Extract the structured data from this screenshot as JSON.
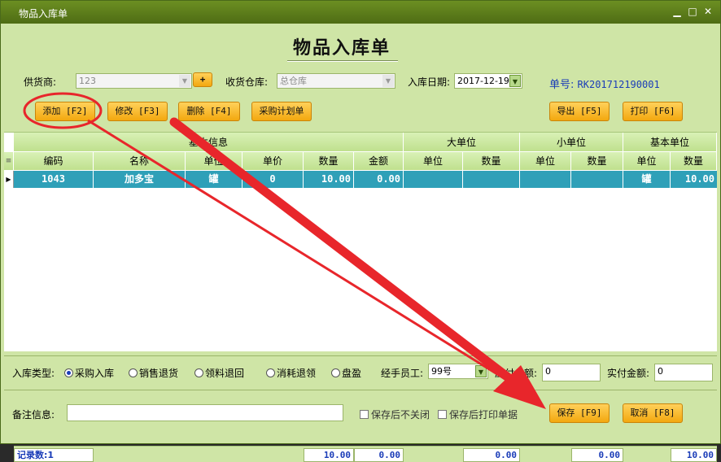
{
  "window": {
    "title": "物品入库单",
    "min": "▁",
    "max": "□",
    "close": "✕"
  },
  "heading": "物品入库单",
  "supplier": {
    "label": "供货商:",
    "value": "123"
  },
  "warehouse": {
    "label": "收货仓库:",
    "value": "总仓库"
  },
  "date": {
    "label": "入库日期:",
    "value": "2017-12-19"
  },
  "docno": {
    "label": "单号:",
    "value": "RK201712190001"
  },
  "plus_label": "+",
  "toolbar": {
    "add": "添加 [F2]",
    "edit": "修改 [F3]",
    "delete": "删除 [F4]",
    "purchase": "采购计划单",
    "export": "导出 [F5]",
    "print": "打印 [F6]"
  },
  "grid": {
    "groups": [
      "基本信息",
      "大单位",
      "小单位",
      "基本单位"
    ],
    "columns": [
      "编码",
      "名称",
      "单位",
      "单价",
      "数量",
      "金额",
      "单位",
      "数量",
      "单位",
      "数量",
      "单位",
      "数量"
    ],
    "row": [
      "1043",
      "加多宝",
      "罐",
      "0",
      "10.00",
      "0.00",
      "",
      "",
      "",
      "",
      "罐",
      "10.00"
    ],
    "footer_label": "记录数:1",
    "footer_values": [
      "10.00",
      "0.00",
      "0.00",
      "0.00",
      "10.00"
    ]
  },
  "type": {
    "label": "入库类型:",
    "options": [
      "采购入库",
      "销售退货",
      "领料退回",
      "消耗退领",
      "盘盈"
    ],
    "selected": 0
  },
  "handler": {
    "label": "经手员工:",
    "value": "99号"
  },
  "payable": {
    "label": "应付金额:",
    "value": "0"
  },
  "paid": {
    "label": "实付金额:",
    "value": "0"
  },
  "remark": {
    "label": "备注信息:",
    "value": ""
  },
  "checks": [
    "保存后不关闭",
    "保存后打印单据"
  ],
  "save": "保存 [F9]",
  "cancel": "取消 [F8]",
  "colors": {
    "accent": "#f3a80f",
    "annotation": "#e8262b",
    "row_select": "#2fa0b8"
  }
}
